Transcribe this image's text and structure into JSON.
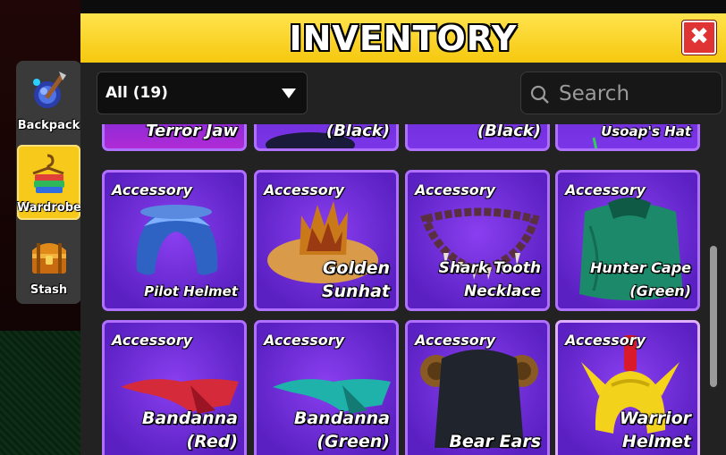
{
  "sidebar": {
    "items": [
      {
        "label": "Backpack",
        "icon": "backpack-icon",
        "active": false
      },
      {
        "label": "Wardrobe",
        "icon": "wardrobe-icon",
        "active": true
      },
      {
        "label": "Stash",
        "icon": "chest-icon",
        "active": false
      }
    ]
  },
  "window": {
    "title": "INVENTORY",
    "close_label": "✖"
  },
  "filter": {
    "selected": "All (19)"
  },
  "search": {
    "placeholder": "Search",
    "value": ""
  },
  "partial_row": [
    {
      "name": "Terror Jaw"
    },
    {
      "name": "(Black)"
    },
    {
      "name": "(Black)"
    },
    {
      "name": "Usoap's Hat"
    }
  ],
  "items": [
    {
      "type": "Accessory",
      "name": "Pilot Helmet",
      "art": "pilot-helmet"
    },
    {
      "type": "Accessory",
      "name": "Golden\nSunhat",
      "art": "golden-sunhat"
    },
    {
      "type": "Accessory",
      "name": "Shark Tooth\nNecklace",
      "art": "shark-tooth-necklace"
    },
    {
      "type": "Accessory",
      "name": "Hunter Cape\n(Green)",
      "art": "hunter-cape"
    },
    {
      "type": "Accessory",
      "name": "Bandanna\n(Red)",
      "art": "bandanna-red"
    },
    {
      "type": "Accessory",
      "name": "Bandanna\n(Green)",
      "art": "bandanna-green"
    },
    {
      "type": "Accessory",
      "name": "Bear Ears",
      "art": "bear-ears"
    },
    {
      "type": "Accessory",
      "name": "Warrior\nHelmet",
      "art": "warrior-helmet"
    }
  ],
  "colors": {
    "title_bar": "#f6c80f",
    "card_border": "#b070ff",
    "card_fill": "#6a2bd6",
    "close_button": "#e03434",
    "active_tab": "#f7c91a"
  }
}
